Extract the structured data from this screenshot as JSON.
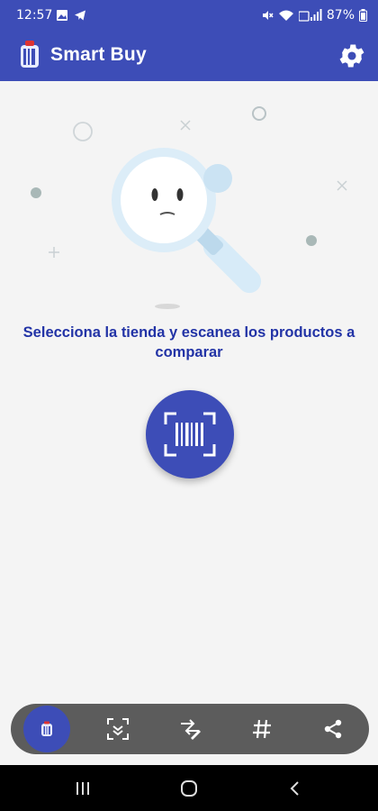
{
  "status_bar": {
    "time": "12:57",
    "battery": "87%",
    "left_icons": [
      "image-icon",
      "telegram-icon"
    ],
    "right_icons": [
      "mute-icon",
      "wifi-icon",
      "signal-icon"
    ]
  },
  "app_bar": {
    "title": "Smart Buy",
    "background": "#3d4db7",
    "settings_icon": "gear-icon"
  },
  "main": {
    "message": "Selecciona la tienda y escanea los productos a comparar",
    "message_color": "#2233a6",
    "scan_button_icon": "barcode-scan-icon"
  },
  "bottom_nav": {
    "items": [
      {
        "icon": "store-icon",
        "active": true
      },
      {
        "icon": "scan-frame-icon",
        "active": false
      },
      {
        "icon": "compare-edit-icon",
        "active": false
      },
      {
        "icon": "hash-icon",
        "active": false
      },
      {
        "icon": "share-icon",
        "active": false
      }
    ]
  },
  "system_nav": {
    "icons": [
      "recents-icon",
      "home-icon",
      "back-icon"
    ]
  }
}
